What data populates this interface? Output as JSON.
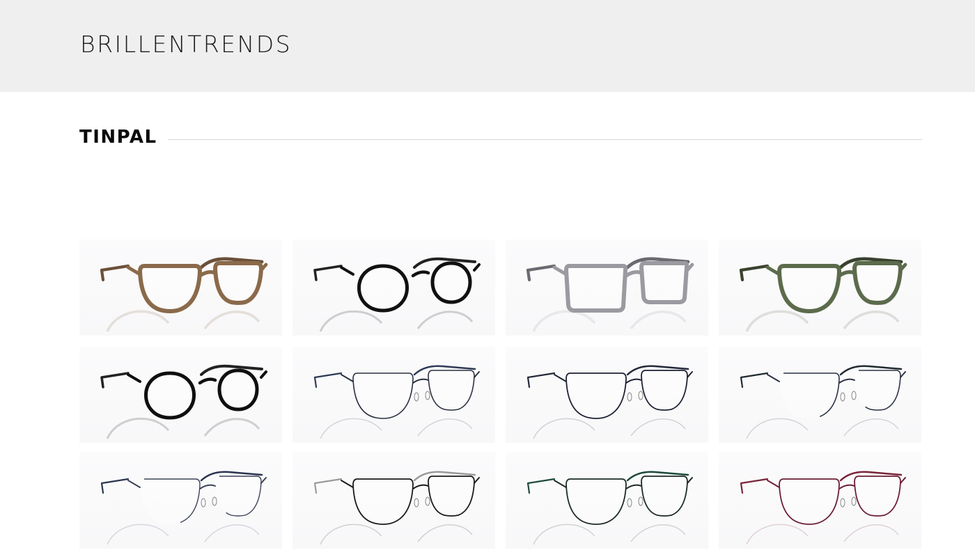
{
  "header": {
    "title": "BRILLENTRENDS"
  },
  "section": {
    "title": "TINPAL"
  },
  "products": [
    {
      "style": "square",
      "color": "#8a6a4a",
      "temple": "#6b5039",
      "thick": 6
    },
    {
      "style": "round",
      "color": "#111111",
      "temple": "#222222",
      "thick": 5
    },
    {
      "style": "rect",
      "color": "#9a9aa0",
      "temple": "#6a6a70",
      "thick": 6
    },
    {
      "style": "square",
      "color": "#5c6b4c",
      "temple": "#39422f",
      "thick": 6
    },
    {
      "style": "round",
      "color": "#0f0f0f",
      "temple": "#222222",
      "thick": 5
    },
    {
      "style": "thinwire",
      "color": "#2a3140",
      "temple": "#2d3a55",
      "thick": 1.6
    },
    {
      "style": "thinwire",
      "color": "#1d2233",
      "temple": "#23283a",
      "thick": 1.8
    },
    {
      "style": "halfrim",
      "color": "#2b3243",
      "temple": "#1f2a30",
      "thick": 1.6
    },
    {
      "style": "halfrim",
      "color": "#3a4256",
      "temple": "#2b3550",
      "thick": 1.4
    },
    {
      "style": "thinwire",
      "color": "#1a1a1a",
      "temple": "#9a9a9a",
      "thick": 1.8
    },
    {
      "style": "thinwire",
      "color": "#1d2a26",
      "temple": "#1d4a38",
      "thick": 1.8
    },
    {
      "style": "thinwire",
      "color": "#6b1f35",
      "temple": "#7a2438",
      "thick": 1.8
    }
  ]
}
